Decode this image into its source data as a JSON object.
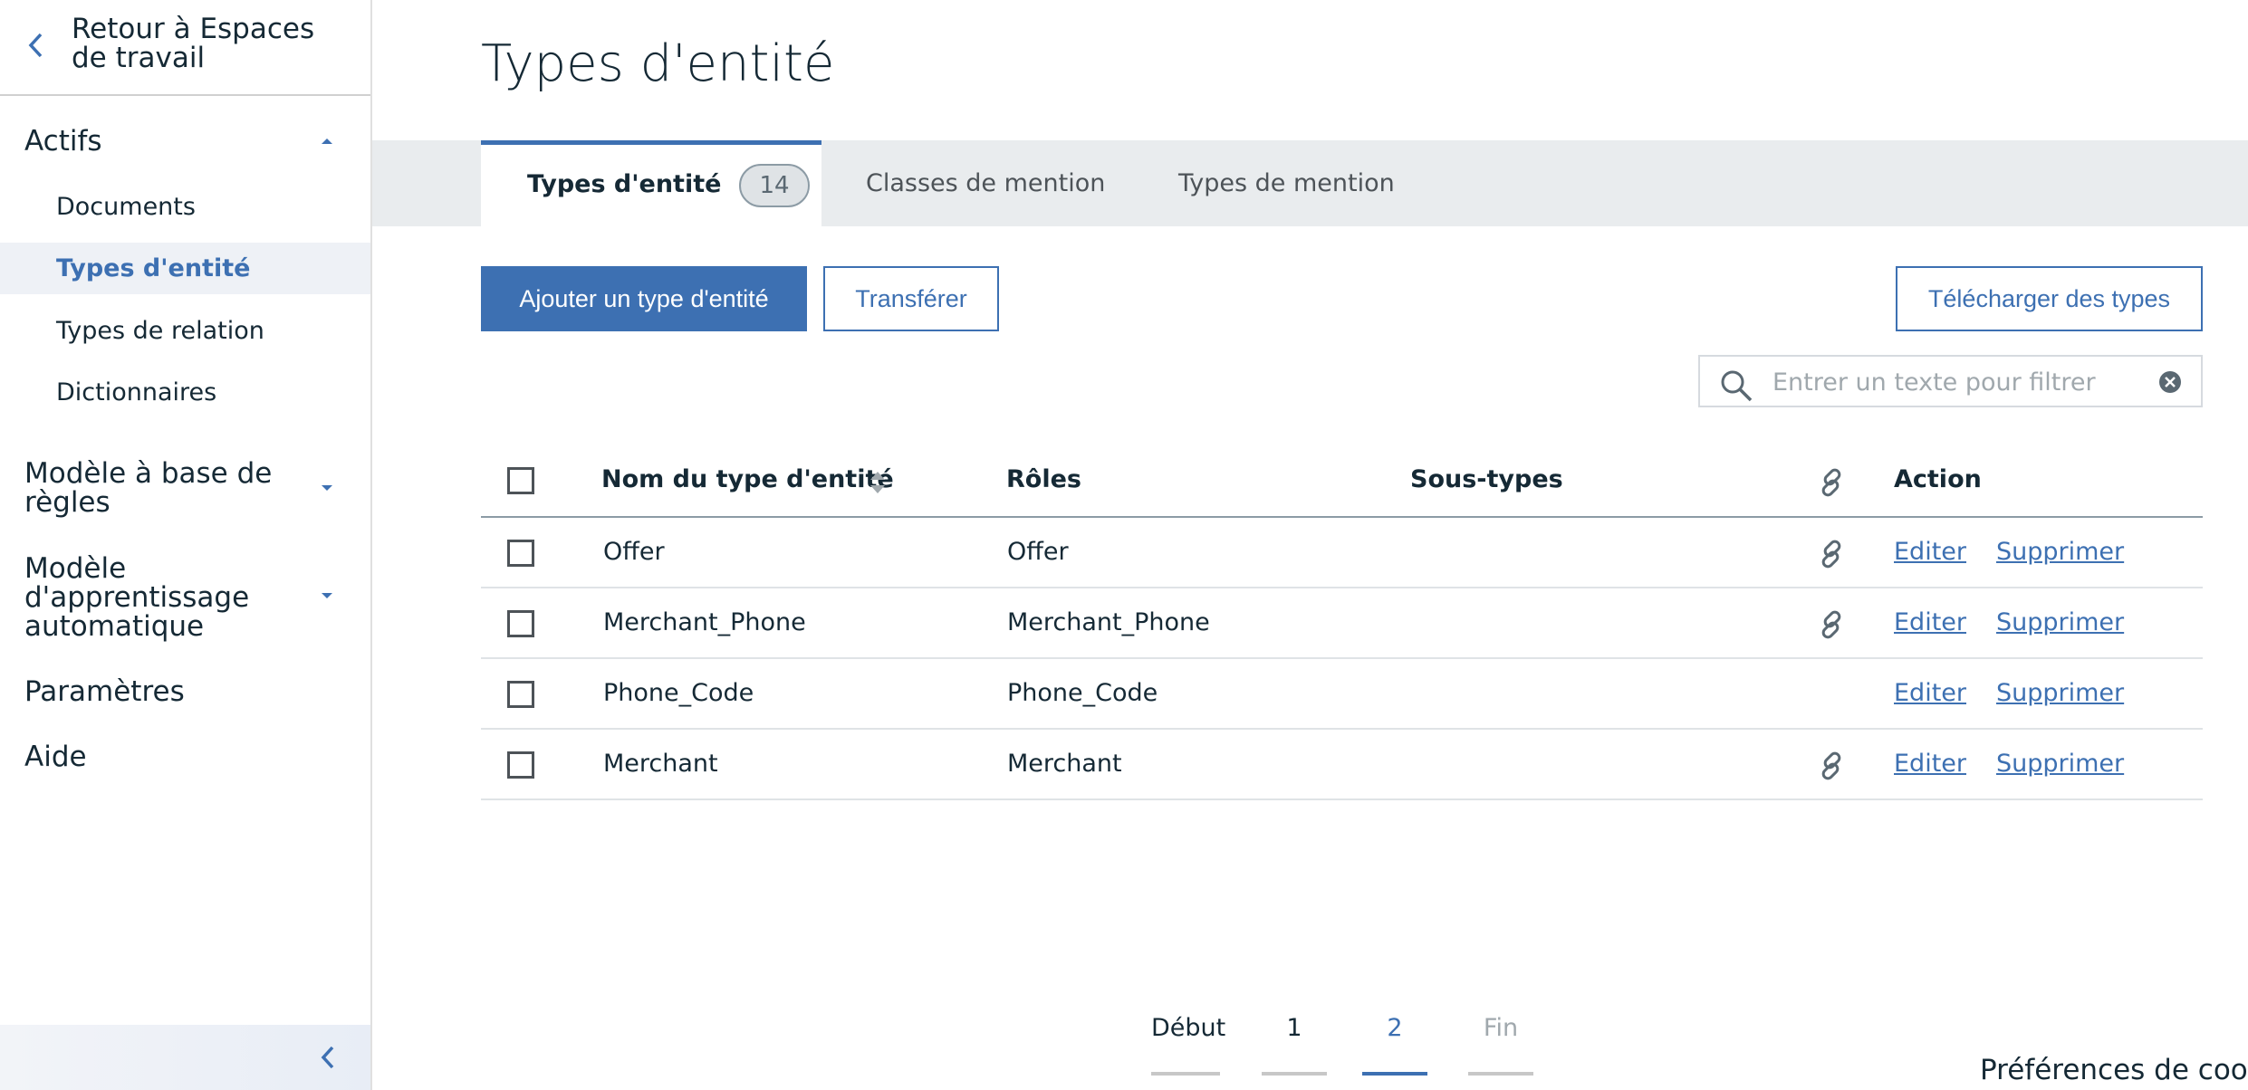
{
  "sidebar": {
    "back_label": "Retour à Espaces de travail",
    "sections": {
      "actifs": "Actifs",
      "rule_model": "Modèle à base de règles",
      "ml_model": "Modèle d'apprentissage automatique",
      "settings": "Paramètres",
      "help": "Aide"
    },
    "actifs_items": [
      "Documents",
      "Types d'entité",
      "Types de relation",
      "Dictionnaires"
    ],
    "active_item": "Types d'entité"
  },
  "page": {
    "title": "Types d'entité"
  },
  "tabs": [
    {
      "label": "Types d'entité",
      "count": "14"
    },
    {
      "label": "Classes de mention"
    },
    {
      "label": "Types de mention"
    }
  ],
  "toolbar": {
    "add_label": "Ajouter un type d'entité",
    "transfer_label": "Transférer",
    "download_label": "Télécharger des types"
  },
  "search": {
    "placeholder": "Entrer un texte pour filtrer"
  },
  "table": {
    "headers": {
      "name": "Nom du type d'entité",
      "roles": "Rôles",
      "subtypes": "Sous-types",
      "action": "Action"
    },
    "rows": [
      {
        "name": "Offer",
        "roles": "Offer",
        "subtypes": "",
        "linked": true,
        "edit": "Editer",
        "delete": "Supprimer"
      },
      {
        "name": "Merchant_Phone",
        "roles": "Merchant_Phone",
        "subtypes": "",
        "linked": true,
        "edit": "Editer",
        "delete": "Supprimer"
      },
      {
        "name": "Phone_Code",
        "roles": "Phone_Code",
        "subtypes": "",
        "linked": false,
        "edit": "Editer",
        "delete": "Supprimer"
      },
      {
        "name": "Merchant",
        "roles": "Merchant",
        "subtypes": "",
        "linked": true,
        "edit": "Editer",
        "delete": "Supprimer"
      }
    ]
  },
  "pagination": {
    "first": "Début",
    "pages": [
      "1",
      "2"
    ],
    "current": "2",
    "last": "Fin"
  },
  "footer": {
    "cookie_label": "Préférences de cooki"
  },
  "colors": {
    "accent": "#3d70b2",
    "text": "#152935",
    "tabbar_bg": "#e9ecee"
  }
}
